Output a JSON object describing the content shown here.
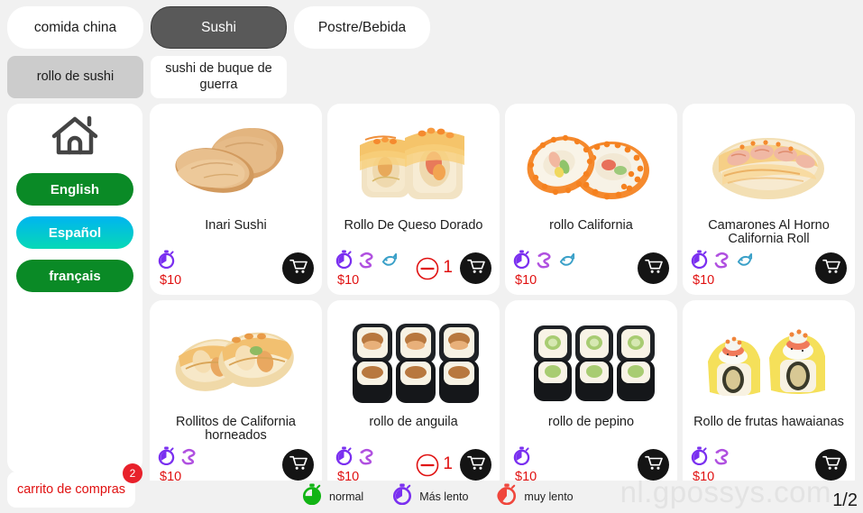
{
  "tabs": [
    {
      "label": "comida china",
      "active": false
    },
    {
      "label": "Sushi",
      "active": true
    },
    {
      "label": "Postre/Bebida",
      "active": false
    }
  ],
  "subtabs": [
    {
      "label": "rollo de sushi",
      "active": true
    },
    {
      "label": "sushi de buque de guerra",
      "active": false
    }
  ],
  "sidebar": {
    "home_icon": "home-icon",
    "languages": [
      {
        "label": "English",
        "active": false
      },
      {
        "label": "Español",
        "active": true
      },
      {
        "label": "français",
        "active": false
      }
    ],
    "active_color": "#07d9b6",
    "inactive_color": "#0a8a26"
  },
  "products": [
    {
      "name": "Inari Sushi",
      "price": "$10",
      "image": "inari-sushi",
      "speed_icons": [
        "stopwatch-purple"
      ],
      "qty": null,
      "cart_icon": "shopping-cart-icon"
    },
    {
      "name": "Rollo De Queso Dorado",
      "price": "$10",
      "image": "golden-cheese-roll",
      "speed_icons": [
        "stopwatch-purple",
        "eel-icon",
        "fish-icon"
      ],
      "qty": "1",
      "cart_icon": "shopping-cart-icon"
    },
    {
      "name": "rollo California",
      "price": "$10",
      "image": "california-roll",
      "speed_icons": [
        "stopwatch-purple",
        "eel-icon",
        "fish-icon"
      ],
      "qty": null,
      "cart_icon": "shopping-cart-icon"
    },
    {
      "name": "Camarones Al Horno California Roll",
      "price": "$10",
      "image": "baked-shrimp-california-roll",
      "speed_icons": [
        "stopwatch-purple",
        "eel-icon",
        "fish-icon"
      ],
      "qty": null,
      "cart_icon": "shopping-cart-icon"
    },
    {
      "name": "Rollitos de California horneados",
      "price": "$10",
      "image": "baked-california-rolls",
      "speed_icons": [
        "stopwatch-purple",
        "eel-icon"
      ],
      "qty": null,
      "cart_icon": "shopping-cart-icon"
    },
    {
      "name": "rollo de anguila",
      "price": "$10",
      "image": "eel-maki-roll",
      "speed_icons": [
        "stopwatch-purple",
        "eel-icon"
      ],
      "qty": "1",
      "cart_icon": "shopping-cart-icon"
    },
    {
      "name": "rollo de pepino",
      "price": "$10",
      "image": "cucumber-maki-roll",
      "speed_icons": [
        "stopwatch-purple"
      ],
      "qty": null,
      "cart_icon": "shopping-cart-icon"
    },
    {
      "name": "Rollo de frutas hawaianas",
      "price": "$10",
      "image": "hawaiian-fruit-roll",
      "speed_icons": [
        "stopwatch-purple",
        "eel-icon"
      ],
      "qty": null,
      "cart_icon": "shopping-cart-icon"
    }
  ],
  "bottom": {
    "cart_label": "carrito de compras",
    "cart_count": "2",
    "legend": [
      {
        "label": "normal",
        "color": "#11b414",
        "icon": "stopwatch-green"
      },
      {
        "label": "Más lento",
        "color": "#7a2ff0",
        "icon": "stopwatch-purple"
      },
      {
        "label": "muy lento",
        "color": "#f0463c",
        "icon": "stopwatch-red"
      }
    ],
    "watermark": "nl.gpossys.com",
    "page_indicator": "1/2"
  }
}
